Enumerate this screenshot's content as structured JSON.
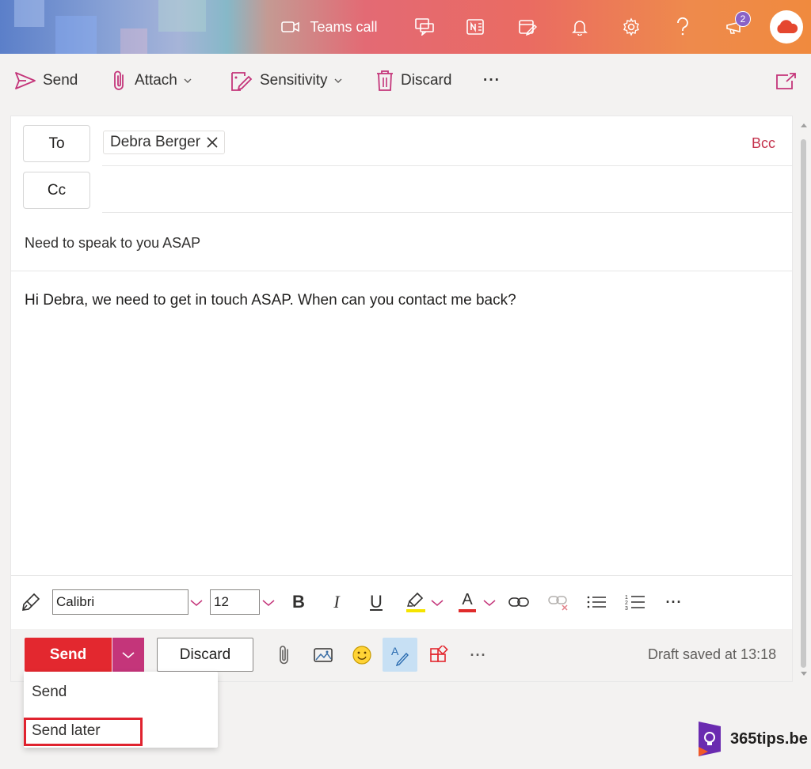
{
  "header": {
    "teams_call_label": "Teams call",
    "notification_count": "2",
    "gradient_accent": "#e36a74"
  },
  "toolbar": {
    "send_label": "Send",
    "attach_label": "Attach",
    "sensitivity_label": "Sensitivity",
    "discard_label": "Discard",
    "more_label": "···",
    "accent_color": "#c4357a"
  },
  "compose": {
    "to_label": "To",
    "cc_label": "Cc",
    "bcc_label": "Bcc",
    "recipients": [
      {
        "name": "Debra Berger"
      }
    ],
    "subject": "Need to speak to you ASAP",
    "body": "Hi Debra, we need to get in touch ASAP. When can you contact me back?"
  },
  "formatting": {
    "font": "Calibri",
    "size": "12",
    "bold_label": "B",
    "italic_label": "I",
    "underline_label": "U",
    "font_color_label": "A",
    "more_label": "···"
  },
  "actions": {
    "send_label": "Send",
    "discard_label": "Discard",
    "more_label": "···",
    "draft_status": "Draft saved at 13:18",
    "send_color": "#e3282f"
  },
  "send_menu": {
    "items": [
      {
        "label": "Send"
      },
      {
        "label": "Send later"
      }
    ],
    "highlight_color": "#e0232f"
  },
  "watermark": {
    "text": "365tips.be"
  }
}
